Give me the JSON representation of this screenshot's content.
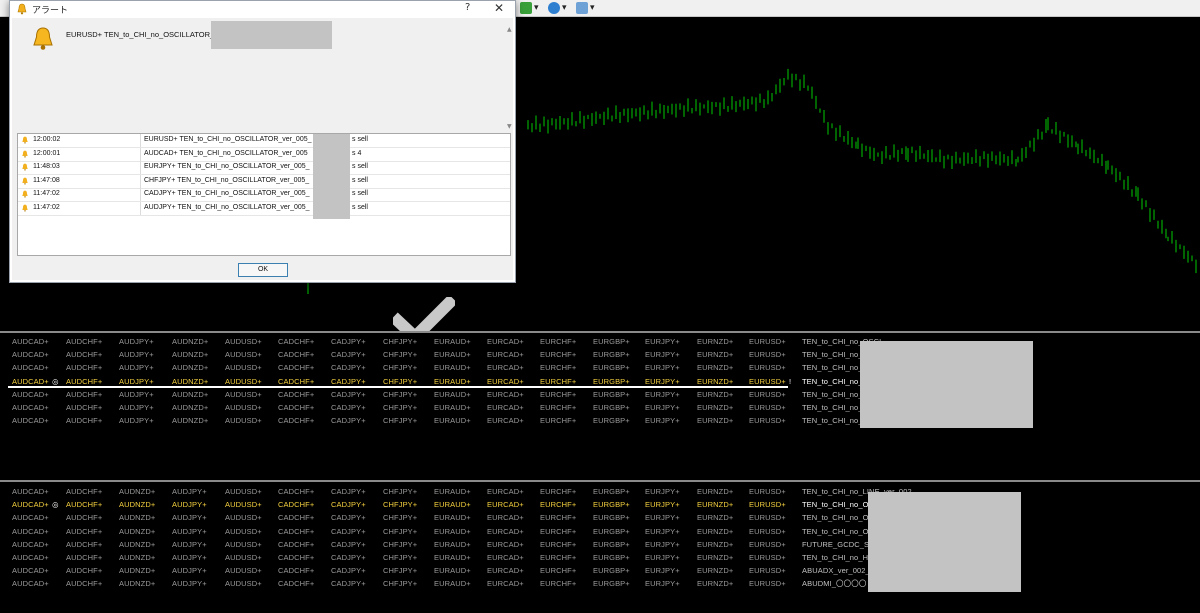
{
  "toolbar": {
    "icons": [
      "chart-add-icon",
      "clock-icon",
      "template-icon"
    ]
  },
  "dialog": {
    "title": "アラート",
    "help_label": "?",
    "close_label": "✕",
    "message": "EURUSD+ TEN_to_CHI_no_OSCILLATOR_ver_",
    "ok_label": "OK",
    "alerts": [
      {
        "time": "12:00:02",
        "message": "EURUSD+ TEN_to_CHI_no_OSCILLATOR_ver_005_",
        "suffix": "s sell"
      },
      {
        "time": "12:00:01",
        "message": "AUDCAD+ TEN_to_CHI_no_OSCILLATOR_ver_005",
        "suffix": "s 4"
      },
      {
        "time": "11:48:03",
        "message": "EURJPY+ TEN_to_CHI_no_OSCILLATOR_ver_005_",
        "suffix": "s sell"
      },
      {
        "time": "11:47:08",
        "message": "CHFJPY+ TEN_to_CHI_no_OSCILLATOR_ver_005_",
        "suffix": "s sell"
      },
      {
        "time": "11:47:02",
        "message": "CADJPY+ TEN_to_CHI_no_OSCILLATOR_ver_005_",
        "suffix": "s sell"
      },
      {
        "time": "11:47:02",
        "message": "AUDJPY+ TEN_to_CHI_no_OSCILLATOR_ver_005_",
        "suffix": "s sell"
      }
    ]
  },
  "panel1": {
    "symbols": [
      "AUDCAD+",
      "AUDCHF+",
      "AUDJPY+",
      "AUDNZD+",
      "AUDUSD+",
      "CADCHF+",
      "CADJPY+",
      "CHFJPY+",
      "EURAUD+",
      "EURCAD+",
      "EURCHF+",
      "EURGBP+",
      "EURJPY+",
      "EURNZD+",
      "EURUSD+"
    ],
    "marker": "◎",
    "end_marker": "!",
    "highlight_row": 3,
    "labels": [
      "TEN_to_CHI_no_OSCI",
      "TEN_to_CHI_no_",
      "TEN_to_CHI_no_",
      "TEN_to_CHI_no_",
      "TEN_to_CHI_no_",
      "TEN_to_CHI_no_",
      "TEN_to_CHI_no_"
    ]
  },
  "panel2": {
    "symbols": [
      "AUDCAD+",
      "AUDCHF+",
      "AUDNZD+",
      "AUDJPY+",
      "AUDUSD+",
      "CADCHF+",
      "CADJPY+",
      "CHFJPY+",
      "EURAUD+",
      "EURCAD+",
      "EURCHF+",
      "EURGBP+",
      "EURJPY+",
      "EURNZD+",
      "EURUSD+"
    ],
    "marker": "◎",
    "highlight_row": 1,
    "labels": [
      "TEN_to_CHI_no_LINE_ver_002",
      "TEN_to_CHI_no_O",
      "TEN_to_CHI_no_O",
      "TEN_to_CHI_no_O",
      "FUTURE_GCDC_S",
      "TEN_to_CHI_no_H",
      "ABUADX_ver_002_",
      "ABUDMI_〇〇〇〇"
    ]
  },
  "colors": {
    "candle": "#00c800",
    "highlight": "#f4d03f",
    "dim_text": "#9a9a9a"
  }
}
